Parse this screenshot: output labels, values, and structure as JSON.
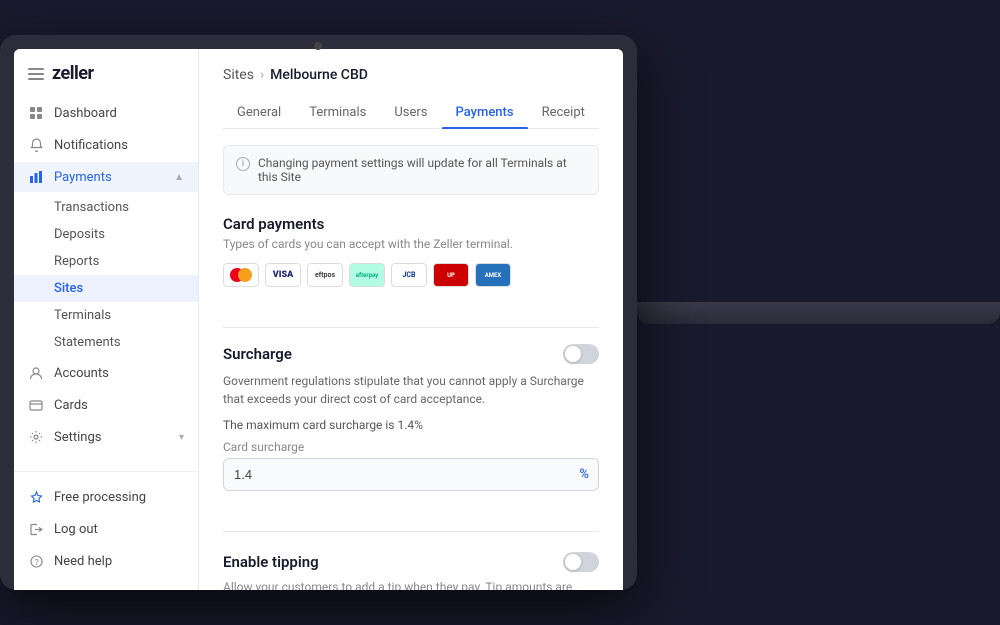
{
  "laptop": {
    "camera_label": "camera"
  },
  "sidebar": {
    "logo": "zeller",
    "menu_icon": "menu",
    "nav_items": [
      {
        "id": "dashboard",
        "label": "Dashboard",
        "icon": "grid",
        "active": false
      },
      {
        "id": "notifications",
        "label": "Notifications",
        "icon": "bell",
        "active": false
      },
      {
        "id": "payments",
        "label": "Payments",
        "icon": "chart",
        "active": true,
        "expandable": true,
        "expanded": true
      }
    ],
    "payments_subitems": [
      {
        "id": "transactions",
        "label": "Transactions",
        "active": false
      },
      {
        "id": "deposits",
        "label": "Deposits",
        "active": false
      },
      {
        "id": "reports",
        "label": "Reports",
        "active": false
      },
      {
        "id": "sites",
        "label": "Sites",
        "active": true
      },
      {
        "id": "terminals",
        "label": "Terminals",
        "active": false
      },
      {
        "id": "statements",
        "label": "Statements",
        "active": false
      }
    ],
    "bottom_items": [
      {
        "id": "accounts",
        "label": "Accounts",
        "icon": "account"
      },
      {
        "id": "cards",
        "label": "Cards",
        "icon": "card"
      },
      {
        "id": "settings",
        "label": "Settings",
        "icon": "gear",
        "expandable": true
      }
    ],
    "footer_items": [
      {
        "id": "free-processing",
        "label": "Free processing",
        "icon": "star"
      },
      {
        "id": "log-out",
        "label": "Log out",
        "icon": "logout"
      },
      {
        "id": "need-help",
        "label": "Need help",
        "icon": "help"
      }
    ]
  },
  "breadcrumb": {
    "parent": "Sites",
    "separator": "›",
    "current": "Melbourne CBD"
  },
  "tabs": [
    {
      "id": "general",
      "label": "General",
      "active": false
    },
    {
      "id": "terminals",
      "label": "Terminals",
      "active": false
    },
    {
      "id": "users",
      "label": "Users",
      "active": false
    },
    {
      "id": "payments",
      "label": "Payments",
      "active": true
    },
    {
      "id": "receipt",
      "label": "Receipt",
      "active": false
    }
  ],
  "info_banner": {
    "text": "Changing payment settings will update for all Terminals at this Site"
  },
  "card_payments": {
    "title": "Card payments",
    "subtitle": "Types of cards you can accept with the Zeller terminal.",
    "card_types": [
      {
        "id": "mastercard",
        "label": "MC"
      },
      {
        "id": "visa",
        "label": "VISA"
      },
      {
        "id": "eftpos",
        "label": "eftpos"
      },
      {
        "id": "afterpay",
        "label": "AP"
      },
      {
        "id": "jcb",
        "label": "JCB"
      },
      {
        "id": "unionpay",
        "label": "UP"
      },
      {
        "id": "amex",
        "label": "AMEX"
      }
    ]
  },
  "surcharge": {
    "title": "Surcharge",
    "toggle_on": false,
    "description": "Government regulations stipulate that you cannot apply a Surcharge that exceeds your direct cost of card acceptance.",
    "max_text": "The maximum card surcharge is 1.4%",
    "input_label": "Card surcharge",
    "input_value": "1.4",
    "input_placeholder": "1.4",
    "input_suffix": "%"
  },
  "tipping": {
    "title": "Enable tipping",
    "toggle_on": false,
    "description": "Allow your customers to add a tip when they pay. Tip amounts are"
  }
}
